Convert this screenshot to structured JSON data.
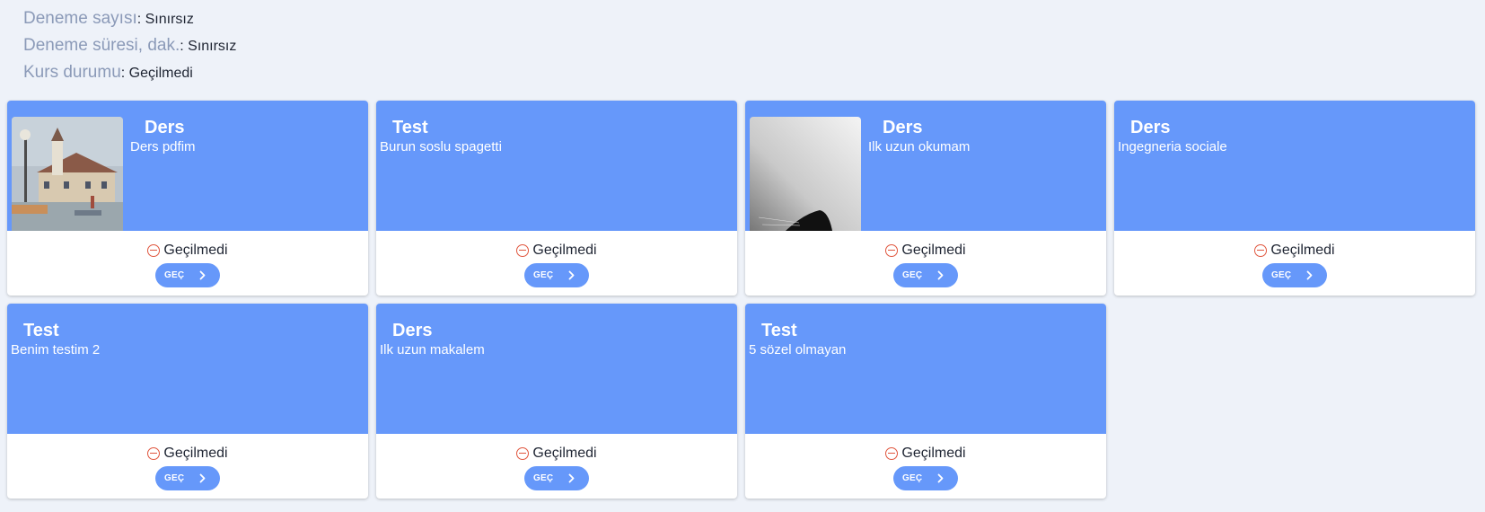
{
  "info": {
    "attempts_label": "Deneme sayısı",
    "attempts_value": ": Sınırsız",
    "duration_label": "Deneme süresi, dak.",
    "duration_value": ": Sınırsız",
    "status_label": "Kurs durumu",
    "status_value": ": Geçilmedi"
  },
  "colors": {
    "card_header": "#6698fa",
    "status_icon": "#e0563e",
    "background": "#eef2f9"
  },
  "cards": [
    {
      "type": "Ders",
      "title": "Ders pdfim",
      "thumb": "painting",
      "status": "Geçilmedi",
      "button": "GEÇ"
    },
    {
      "type": "Test",
      "title": "Burun soslu spagetti",
      "thumb": null,
      "status": "Geçilmedi",
      "button": "GEÇ"
    },
    {
      "type": "Ders",
      "title": "Ilk uzun okumam",
      "thumb": "cat",
      "status": "Geçilmedi",
      "button": "GEÇ"
    },
    {
      "type": "Ders",
      "title": "Ingegneria sociale",
      "thumb": null,
      "status": "Geçilmedi",
      "button": "GEÇ"
    },
    {
      "type": "Test",
      "title": "Benim testim 2",
      "thumb": null,
      "status": "Geçilmedi",
      "button": "GEÇ"
    },
    {
      "type": "Ders",
      "title": "Ilk uzun makalem",
      "thumb": null,
      "status": "Geçilmedi",
      "button": "GEÇ"
    },
    {
      "type": "Test",
      "title": "5 sözel olmayan",
      "thumb": null,
      "status": "Geçilmedi",
      "button": "GEÇ"
    }
  ]
}
